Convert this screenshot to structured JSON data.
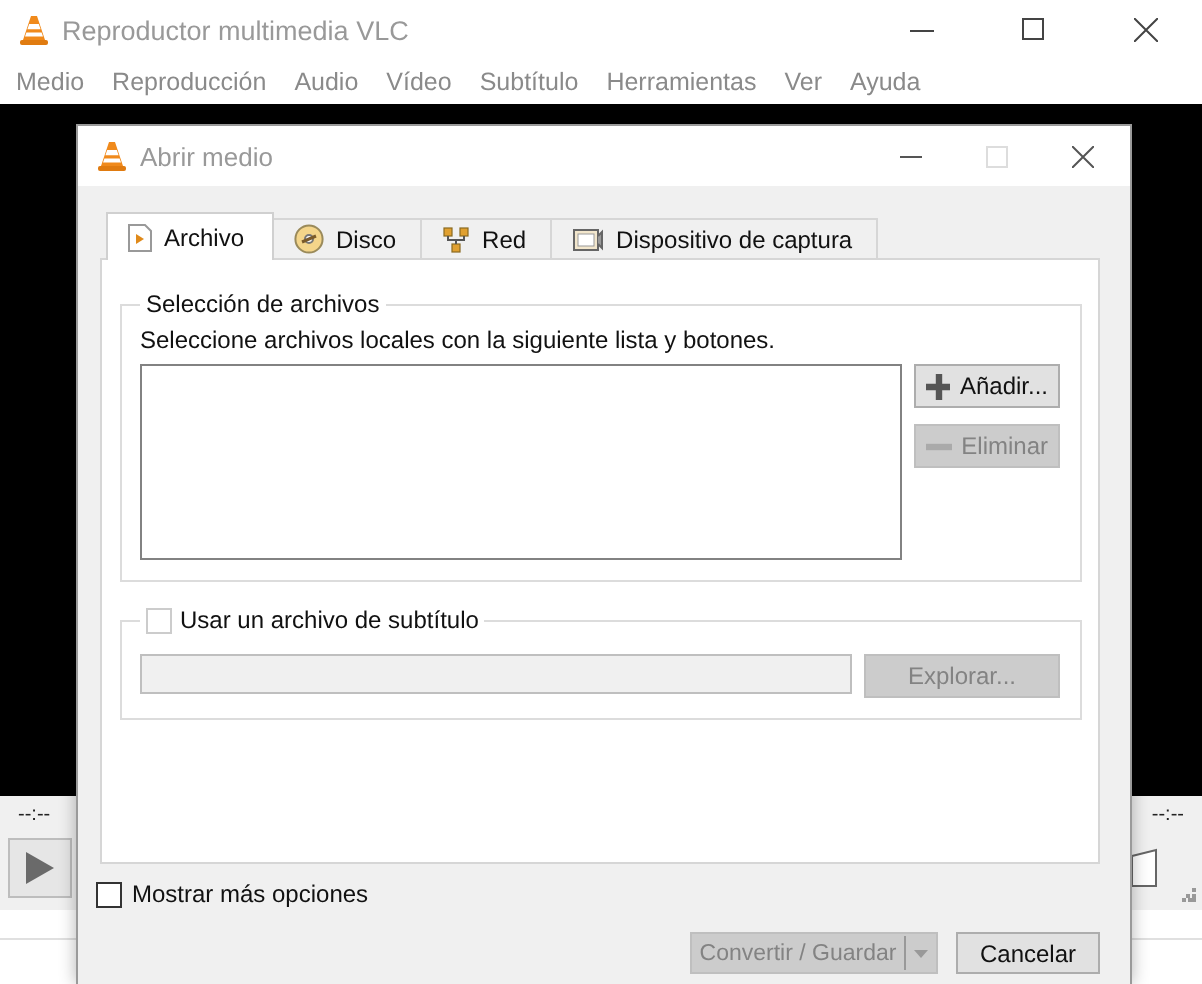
{
  "main_window": {
    "title": "Reproductor multimedia VLC",
    "menu": [
      "Medio",
      "Reproducción",
      "Audio",
      "Vídeo",
      "Subtítulo",
      "Herramientas",
      "Ver",
      "Ayuda"
    ],
    "time_elapsed": "--:--",
    "time_total": "--:--"
  },
  "dialog": {
    "title": "Abrir medio",
    "tabs": [
      {
        "label": "Archivo",
        "selected": true
      },
      {
        "label": "Disco",
        "selected": false
      },
      {
        "label": "Red",
        "selected": false
      },
      {
        "label": "Dispositivo de captura",
        "selected": false
      }
    ],
    "file_group": {
      "title": "Selección de archivos",
      "instruction": "Seleccione archivos locales con la siguiente lista y botones.",
      "buttons": [
        {
          "kind": "add",
          "label": "Añadir...",
          "disabled": false
        },
        {
          "kind": "remove",
          "label": "Eliminar",
          "disabled": true
        }
      ]
    },
    "subtitle": {
      "label": "Usar un archivo de subtítulo",
      "checked": false,
      "browse": {
        "label": "Explorar...",
        "disabled": true
      }
    },
    "more_options": {
      "label": "Mostrar más opciones",
      "checked": false
    },
    "convert": {
      "label": "Convertir / Guardar",
      "disabled": true
    },
    "cancel": {
      "label": "Cancelar",
      "disabled": false
    }
  }
}
